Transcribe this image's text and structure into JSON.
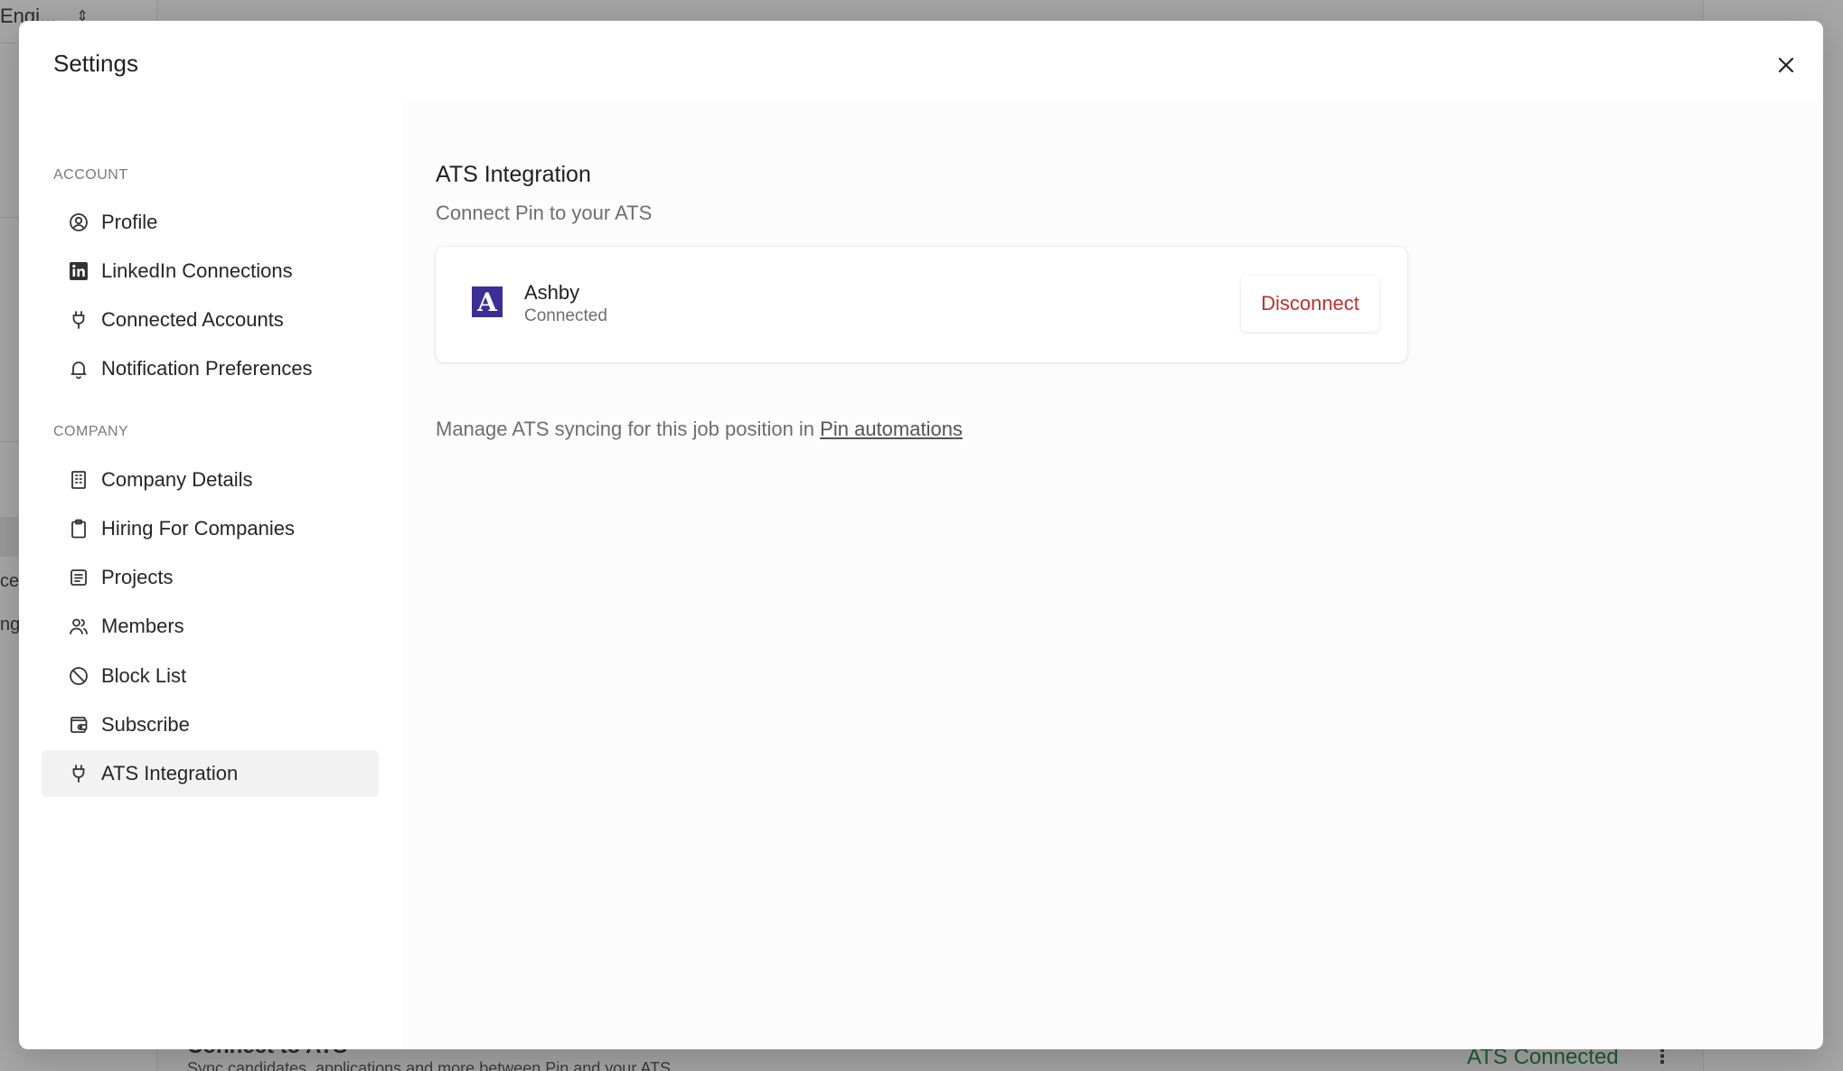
{
  "background": {
    "select_value": "Engi...",
    "frag_1": "ce",
    "frag_2": "ng",
    "bottom_title": "Connect to ATS",
    "bottom_sub": "Sync candidates, applications and more between Pin and your ATS",
    "ats_connected": "ATS Connected",
    "ats_connected_color": "#1e5a2a"
  },
  "modal": {
    "title": "Settings",
    "close_icon": "close-icon"
  },
  "sidebar": {
    "account_label": "ACCOUNT",
    "company_label": "COMPANY",
    "account_items": [
      {
        "label": "Profile",
        "icon": "user-circle-icon"
      },
      {
        "label": "LinkedIn Connections",
        "icon": "linkedin-icon"
      },
      {
        "label": "Connected Accounts",
        "icon": "plug-icon"
      },
      {
        "label": "Notification Preferences",
        "icon": "bell-icon"
      }
    ],
    "company_items": [
      {
        "label": "Company Details",
        "icon": "building-icon"
      },
      {
        "label": "Hiring For Companies",
        "icon": "clipboard-icon"
      },
      {
        "label": "Projects",
        "icon": "list-document-icon"
      },
      {
        "label": "Members",
        "icon": "users-icon"
      },
      {
        "label": "Block List",
        "icon": "ban-icon"
      },
      {
        "label": "Subscribe",
        "icon": "wallet-icon"
      },
      {
        "label": "ATS Integration",
        "icon": "plug-icon",
        "active": true
      }
    ]
  },
  "content": {
    "title": "ATS Integration",
    "subtitle": "Connect Pin to your ATS",
    "integration": {
      "logo_letter": "A",
      "name": "Ashby",
      "status": "Connected",
      "action_label": "Disconnect",
      "action_color": "#c0302b",
      "logo_color": "#3b2f96"
    },
    "manage_text": "Manage ATS syncing for this job position in",
    "manage_link": "Pin automations"
  }
}
